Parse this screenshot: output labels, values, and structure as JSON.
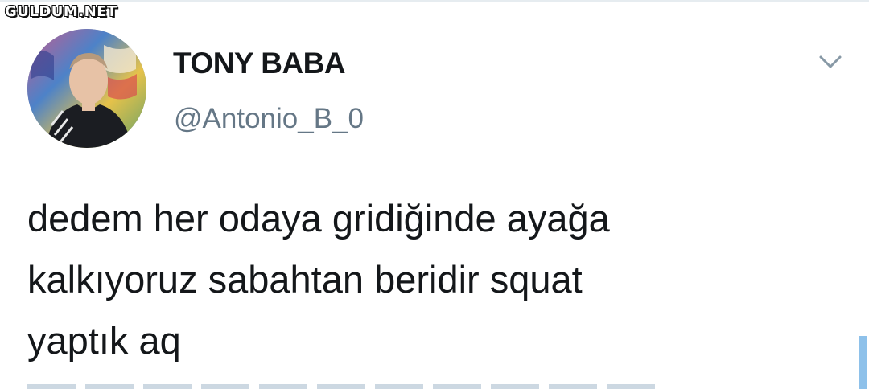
{
  "watermark": {
    "text": "GULDUM.NET"
  },
  "tweet": {
    "display_name": "TONY BABA",
    "handle": "@Antonio_B_0",
    "text_lines": [
      "dedem her odaya gridiğinde ayağa",
      "kalkıyoruz sabahtan beridir squat",
      "yaptık aq"
    ]
  },
  "icons": {
    "menu": "chevron-down-icon",
    "avatar": "profile-photo"
  },
  "colors": {
    "text": "#14171a",
    "secondary": "#657786",
    "accent": "#1da1f2"
  }
}
